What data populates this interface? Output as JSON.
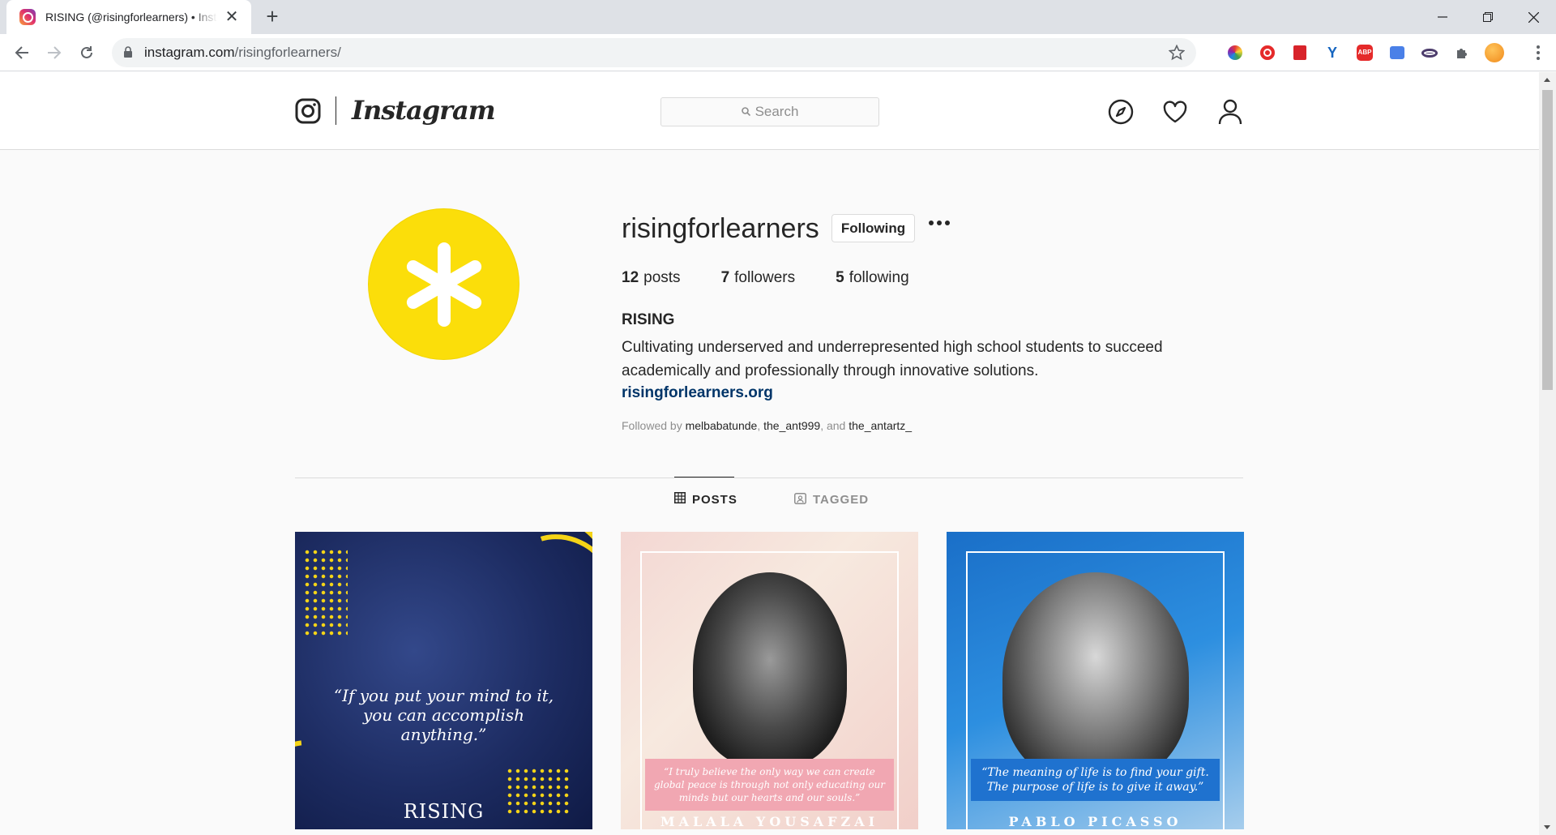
{
  "browser": {
    "tab_title": "RISING (@risingforlearners) • Instagram photos and videos",
    "tab_close": "✕",
    "new_tab": "+",
    "url_host": "instagram.com",
    "url_path": "/risingforlearners/"
  },
  "header": {
    "wordmark": "Instagram",
    "search_placeholder": "Search"
  },
  "profile": {
    "username": "risingforlearners",
    "following_button": "Following",
    "posts_count": "12",
    "posts_label": "posts",
    "followers_count": "7",
    "followers_label": "followers",
    "following_count": "5",
    "following_label": "following",
    "full_name": "RISING",
    "bio": "Cultivating underserved and underrepresented high school students to succeed academically and professionally through innovative solutions.",
    "website": "risingforlearners.org",
    "followed_by_prefix": "Followed by",
    "followed_by_1": "melbabatunde",
    "followed_by_2": "the_ant999",
    "followed_by_conj": ", and",
    "followed_by_3": "the_antartz_",
    "accent_color": "#fbde0a"
  },
  "tabs": {
    "posts": "POSTS",
    "tagged": "TAGGED"
  },
  "posts": [
    {
      "quote": "“If you put your mind to it, you can accomplish anything.”",
      "signature": "RISING"
    },
    {
      "quote": "“I truly believe the only way we can create global peace is through not only educating our minds but our hearts and our souls.”",
      "signature": "MALALA YOUSAFZAI"
    },
    {
      "quote": "“The meaning of life is to find your gift. The purpose of life is to give it away.”",
      "signature": "PABLO PICASSO"
    }
  ],
  "icons": {
    "explore": "compass-icon",
    "activity": "heart-icon",
    "profile": "person-icon"
  }
}
